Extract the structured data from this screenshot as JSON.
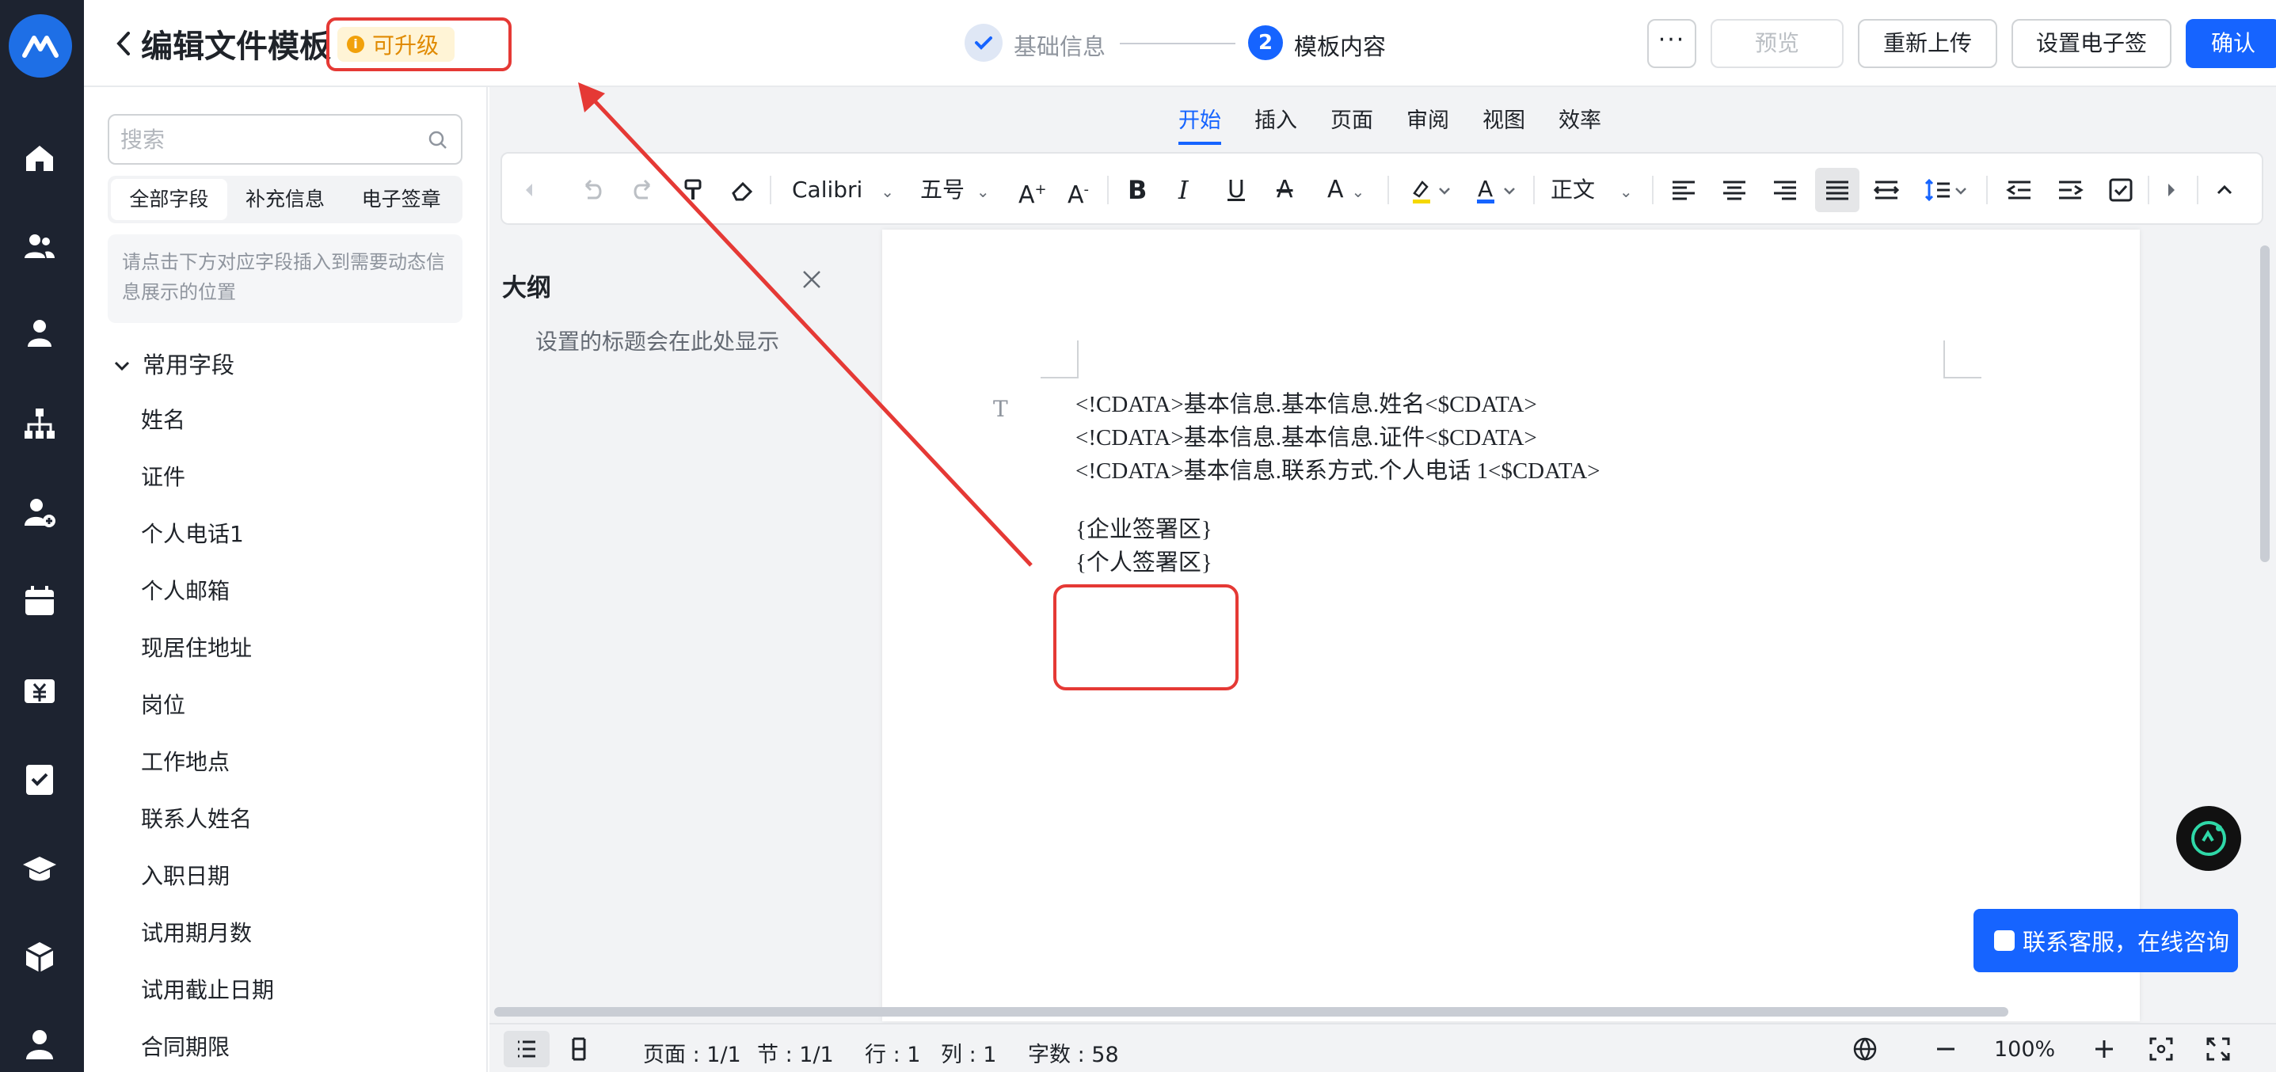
{
  "header": {
    "title": "编辑文件模板",
    "badge": "可升级",
    "steps": [
      {
        "number": "",
        "label": "基础信息"
      },
      {
        "number": "2",
        "label": "模板内容"
      }
    ],
    "more_label": "···",
    "preview_label": "预览",
    "reupload_label": "重新上传",
    "set_signature_label": "设置电子签",
    "confirm_label": "确认"
  },
  "sidebar": {
    "search_placeholder": "搜索",
    "tabs": [
      "全部字段",
      "补充信息",
      "电子签章"
    ],
    "hint": "请点击下方对应字段插入到需要动态信息展示的位置",
    "group_label": "常用字段",
    "fields": [
      "姓名",
      "证件",
      "个人电话1",
      "个人邮箱",
      "现居住地址",
      "岗位",
      "工作地点",
      "联系人姓名",
      "入职日期",
      "试用期月数",
      "试用截止日期",
      "合同期限"
    ]
  },
  "editor": {
    "menu": [
      "开始",
      "插入",
      "页面",
      "审阅",
      "视图",
      "效率"
    ],
    "active_menu": "开始",
    "toolbar": {
      "font_family": "Calibri",
      "font_size": "五号",
      "paragraph_style": "正文"
    },
    "outline": {
      "title": "大纲",
      "hint": "设置的标题会在此处显示"
    },
    "document": {
      "lines": [
        "<!CDATA>基本信息.基本信息.姓名<$CDATA>",
        "<!CDATA>基本信息.基本信息.证件<$CDATA>",
        "<!CDATA>基本信息.联系方式.个人电话 1<$CDATA>"
      ],
      "signature_lines": [
        "{企业签署区}",
        "{个人签署区}"
      ]
    },
    "support_button": "联系客服，在线咨询"
  },
  "statusbar": {
    "page": "页面 : 1/1",
    "section": "节 : 1/1",
    "row": "行 : 1",
    "column": "列 : 1",
    "word_count": "字数 : 58",
    "zoom": "100%"
  },
  "colors": {
    "accent": "#1664ff",
    "annotation": "#e53935",
    "rail": "#1d2330",
    "badge_bg": "#fff4d6",
    "badge_text": "#e08a00"
  },
  "icons": {
    "rail": [
      "home-icon",
      "team-icon",
      "person-icon",
      "org-chart-icon",
      "add-person-icon",
      "calendar-icon",
      "salary-icon",
      "approval-icon",
      "graduation-cap-icon",
      "box-icon",
      "user-icon"
    ]
  }
}
